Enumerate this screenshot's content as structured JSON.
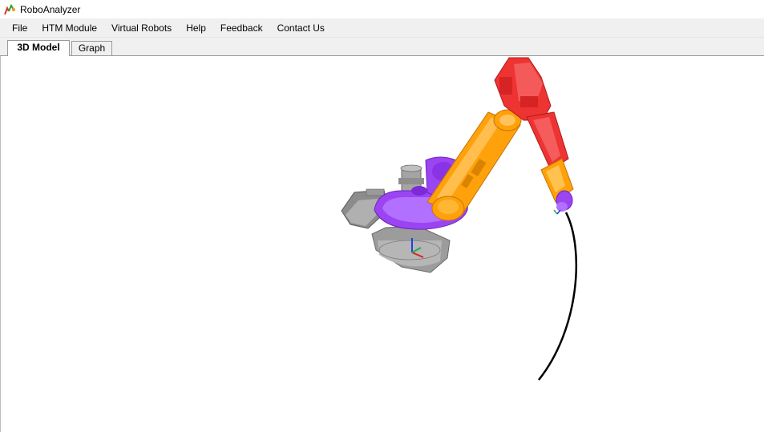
{
  "window": {
    "title": "RoboAnalyzer",
    "icon": "roboanalyzer-logo-icon"
  },
  "menu": [
    {
      "key": "file",
      "label": "File"
    },
    {
      "key": "htm-module",
      "label": "HTM Module"
    },
    {
      "key": "virtual-robots",
      "label": "Virtual Robots"
    },
    {
      "key": "help",
      "label": "Help"
    },
    {
      "key": "feedback",
      "label": "Feedback"
    },
    {
      "key": "contact-us",
      "label": "Contact Us"
    }
  ],
  "tabs": [
    {
      "key": "3d-model",
      "label": "3D Model",
      "active": true
    },
    {
      "key": "graph",
      "label": "Graph",
      "active": false
    }
  ],
  "scene": {
    "colors": {
      "base": "#a6a6a6",
      "turret": "#9b45f2",
      "upper_arm": "#ffa10a",
      "forearm": "#ee3333",
      "trajectory": "#000000",
      "axis_x": "#e02020",
      "axis_y": "#20b040",
      "axis_z": "#2040e0"
    }
  }
}
